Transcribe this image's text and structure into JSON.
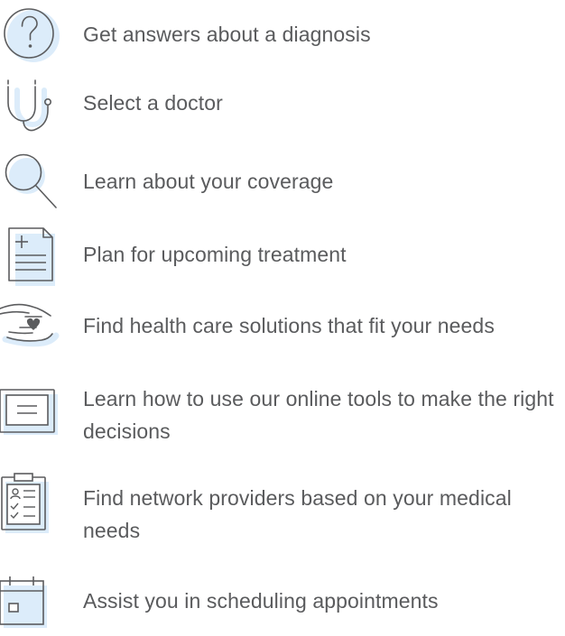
{
  "items": [
    {
      "icon": "question-circle-icon",
      "label": "Get answers about a diagnosis"
    },
    {
      "icon": "stethoscope-icon",
      "label": "Select a doctor"
    },
    {
      "icon": "magnifier-icon",
      "label": "Learn about your coverage"
    },
    {
      "icon": "medical-document-icon",
      "label": "Plan for upcoming treatment"
    },
    {
      "icon": "hands-heart-icon",
      "label": "Find health care solutions that fit your needs"
    },
    {
      "icon": "computer-monitor-icon",
      "label": "Learn how to use our online tools to make the right decisions"
    },
    {
      "icon": "clipboard-checklist-icon",
      "label": "Find network providers based on your medical needs"
    },
    {
      "icon": "calendar-icon",
      "label": "Assist you in scheduling appointments"
    }
  ],
  "colors": {
    "icon_stroke": "#5b5c5e",
    "icon_accent": "#dcecfa",
    "text": "#5a5b5d"
  }
}
